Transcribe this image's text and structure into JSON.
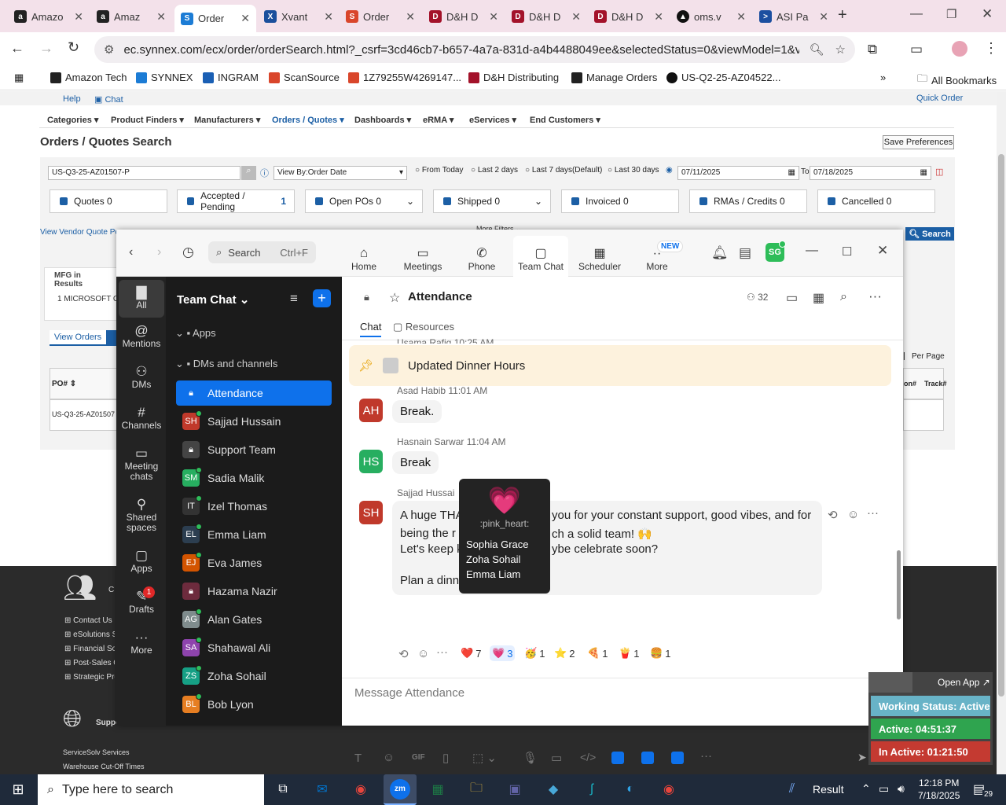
{
  "browser": {
    "tabs": [
      {
        "label": "Amazo",
        "icon": "amazon-icon"
      },
      {
        "label": "Amaz",
        "icon": "amazon-icon"
      },
      {
        "label": "Order",
        "icon": "synnex-icon"
      },
      {
        "label": "Xvant",
        "icon": "xvant-icon"
      },
      {
        "label": "Order",
        "icon": "scansource-icon"
      },
      {
        "label": "D&H D",
        "icon": "dh-icon"
      },
      {
        "label": "D&H D",
        "icon": "dh-icon"
      },
      {
        "label": "D&H D",
        "icon": "dh-icon"
      },
      {
        "label": "oms.v",
        "icon": "oms-icon"
      },
      {
        "label": "ASI Pa",
        "icon": "asi-icon"
      }
    ],
    "url": "ec.synnex.com/ecx/order/orderSearch.html?_csrf=3cd46cb7-b657-4a7a-831d-a4b4488049ee&selectedStatus=0&viewModel=1&viewBy...",
    "bookmarks": [
      "Amazon Tech",
      "SYNNEX",
      "INGRAM",
      "ScanSource",
      "1Z79255W4269147...",
      "D&H Distributing",
      "Manage Orders",
      "US-Q2-25-AZ04522..."
    ],
    "all_bookmarks": "All Bookmarks"
  },
  "page": {
    "help": "Help",
    "chat": "Chat",
    "quick_order": "Quick Order",
    "nav": [
      "Categories",
      "Product Finders",
      "Manufacturers",
      "Orders / Quotes",
      "Dashboards",
      "eRMA",
      "eServices",
      "End Customers"
    ],
    "title": "Orders / Quotes Search",
    "save_prefs": "Save Preferences",
    "search_value": "US-Q3-25-AZ01507-P",
    "view_by": "View By:Order Date",
    "radios": [
      "From Today",
      "Last 2 days",
      "Last 7 days(Default)",
      "Last 30 days"
    ],
    "date_from": "07/11/2025",
    "to_label": "To",
    "date_to": "07/18/2025",
    "statuses": [
      {
        "label": "Quotes 0"
      },
      {
        "label": "Accepted / Pending",
        "count": "1"
      },
      {
        "label": "Open POs 0"
      },
      {
        "label": "Shipped 0"
      },
      {
        "label": "Invoiced 0"
      },
      {
        "label": "RMAs / Credits 0"
      },
      {
        "label": "Cancelled 0"
      }
    ],
    "vendor_quote": "View Vendor Quote Port",
    "more_filters": "More Filters",
    "search_btn": "Search",
    "mfg_results": "MFG in Results",
    "mfg_item": "1  MICROSOFT C",
    "view_orders": "View Orders",
    "po_header": "PO#",
    "po_value": "US-Q3-25-AZ01507",
    "per_page": "Per Page",
    "col_on": "on#",
    "col_track": "Track#",
    "footer_contact": "Contact Us",
    "footer_links": [
      "Contact Us",
      "eSolutions Se",
      "Financial Solu",
      "Post-Sales C",
      "Strategic Pro"
    ],
    "footer_support": "Suppo",
    "footer_bottom": [
      "ServiceSolv Services",
      "Warehouse Cut-Off Times"
    ]
  },
  "zoom": {
    "search_placeholder": "Search",
    "search_shortcut": "Ctrl+F",
    "top_tabs": [
      "Home",
      "Meetings",
      "Phone",
      "Team Chat",
      "Scheduler",
      "More"
    ],
    "new_badge": "NEW",
    "avatar_initials": "SG",
    "rail": [
      {
        "label": "All"
      },
      {
        "label": "Mentions"
      },
      {
        "label": "DMs"
      },
      {
        "label": "Channels"
      },
      {
        "label": "Meeting chats"
      },
      {
        "label": "Shared spaces"
      },
      {
        "label": "Apps"
      },
      {
        "label": "Drafts",
        "badge": "1"
      },
      {
        "label": "More"
      }
    ],
    "sidebar_title": "Team Chat",
    "sections": [
      "Apps",
      "DMs and channels"
    ],
    "channels": [
      {
        "name": "Attendance",
        "initials": "",
        "color": "#0e71eb"
      },
      {
        "name": "Sajjad Hussain",
        "initials": "SH",
        "color": "#c0392b"
      },
      {
        "name": "Support Team",
        "initials": "",
        "color": "#444444"
      },
      {
        "name": "Sadia Malik",
        "initials": "SM",
        "color": "#27ae60"
      },
      {
        "name": "Izel Thomas",
        "initials": "IT",
        "color": "#333333"
      },
      {
        "name": "Emma Liam",
        "initials": "EL",
        "color": "#2c3e50"
      },
      {
        "name": "Eva James",
        "initials": "EJ",
        "color": "#d35400"
      },
      {
        "name": "Hazama Nazir",
        "initials": "",
        "color": "#6d2b3d"
      },
      {
        "name": "Alan Gates",
        "initials": "AG",
        "color": "#7f8c8d"
      },
      {
        "name": "Shahawal Ali",
        "initials": "SA",
        "color": "#8e44ad"
      },
      {
        "name": "Zoha Sohail",
        "initials": "ZS",
        "color": "#16a085"
      },
      {
        "name": "Bob Lyon",
        "initials": "BL",
        "color": "#e67e22"
      }
    ],
    "chat_title": "Attendance",
    "member_count": "32",
    "chat_tabs": [
      "Chat",
      "Resources"
    ],
    "partial_top": "Usama Rafiq 10:25 AM",
    "pinned": "Updated Dinner Hours",
    "messages": [
      {
        "initials": "AH",
        "name": "Asad Habib",
        "time": "11:01 AM",
        "text": "Break."
      },
      {
        "initials": "HS",
        "name": "Hasnain Sarwar",
        "time": "11:04 AM",
        "text": "Break"
      },
      {
        "initials": "SH",
        "name": "Sajjad Hussai",
        "time": ""
      }
    ],
    "long_msg": {
      "line1a": "A huge THA",
      "line1b": "you for your constant support, good vibes, and for",
      "line2a": "being the r",
      "line2b": "ch a solid team! 🙌",
      "line3a": "Let's keep k",
      "line3b": "ybe celebrate soon?",
      "line4a": "Plan a dinn"
    },
    "reactions": [
      {
        "emoji": "❤️",
        "count": "7"
      },
      {
        "emoji": "💗",
        "count": "3"
      },
      {
        "emoji": "🥳",
        "count": "1"
      },
      {
        "emoji": "⭐",
        "count": "2"
      },
      {
        "emoji": "🍕",
        "count": "1"
      },
      {
        "emoji": "🍟",
        "count": "1"
      },
      {
        "emoji": "🍔",
        "count": "1"
      }
    ],
    "tooltip": {
      "emoji": "💗",
      "code": ":pink_heart:",
      "people": [
        "Sophia Grace",
        "Zoha Sohail",
        "Emma Liam"
      ]
    },
    "composer_placeholder": "Message Attendance",
    "gif": "GIF"
  },
  "widget": {
    "open_app": "Open App ↗",
    "working_status": "Working Status: Active",
    "active": "Active: 04:51:37",
    "inactive": "In Active: 01:21:50"
  },
  "taskbar": {
    "search_placeholder": "Type here to search",
    "result": "Result",
    "time": "12:18 PM",
    "date": "7/18/2025",
    "notif": "29"
  }
}
